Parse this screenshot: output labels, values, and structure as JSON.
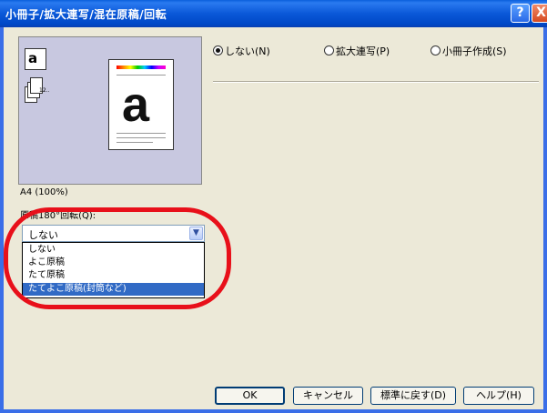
{
  "window": {
    "title": "小冊子/拡大連写/混在原稿/回転"
  },
  "title_buttons": {
    "help": "?",
    "close": "X"
  },
  "preview": {
    "paper_letter": "a",
    "icon_letter": "a",
    "stack_text": "12..",
    "size_label": "A4 (100%)"
  },
  "rotation": {
    "label": "原稿180°回転(Q):",
    "selected": "しない",
    "options": [
      "しない",
      "よこ原稿",
      "たて原稿",
      "たてよこ原稿(封筒など)"
    ],
    "highlighted_index": 3
  },
  "mode": {
    "options": [
      {
        "label": "しない(N)",
        "selected": true
      },
      {
        "label": "拡大連写(P)",
        "selected": false
      },
      {
        "label": "小冊子作成(S)",
        "selected": false
      }
    ]
  },
  "buttons": {
    "ok": "OK",
    "cancel": "キャンセル",
    "defaults": "標準に戻す(D)",
    "help": "ヘルプ(H)"
  },
  "colors": {
    "titlebar": "#0a58d8",
    "client": "#ece9d8",
    "preview_bg": "#c8c8e0",
    "highlight": "#e8101a",
    "selection": "#316ac5"
  }
}
